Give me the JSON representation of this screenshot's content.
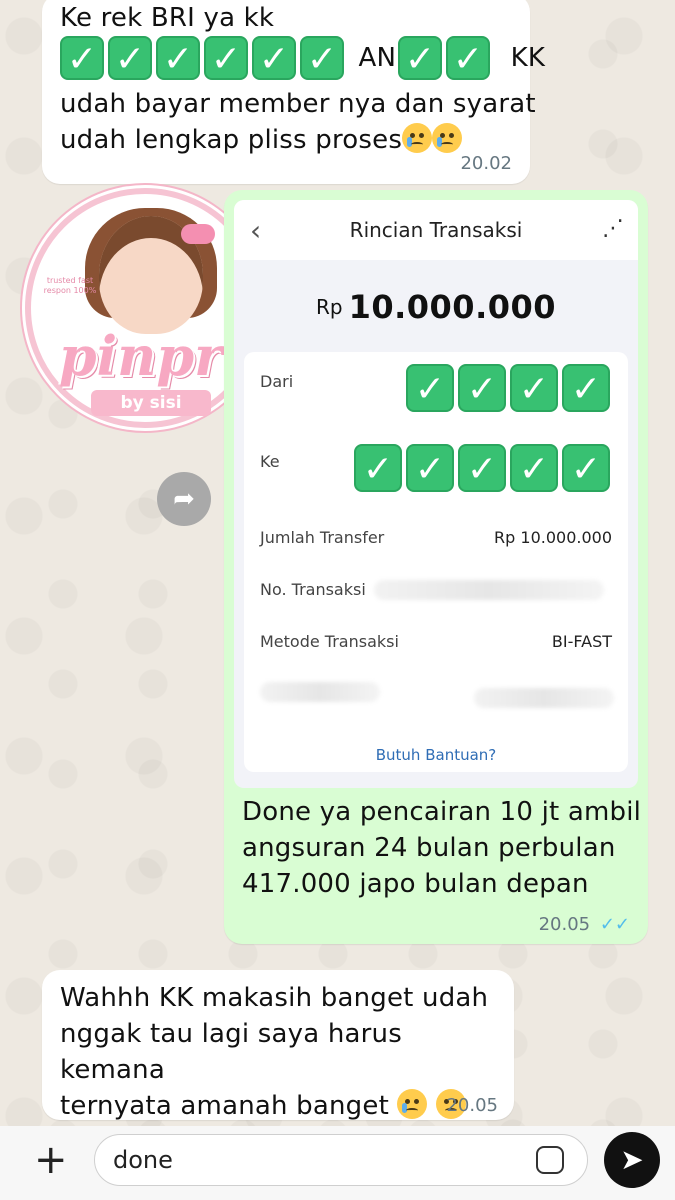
{
  "messages": {
    "m1": {
      "line1": "Ke rek BRI ya kk",
      "an_label": "AN",
      "kk_label": "KK",
      "line3": "udah bayar member nya dan syarat",
      "line4": "udah lengkap pliss proses",
      "time": "20.02"
    },
    "sticker": {
      "title": "pinpri",
      "subtitle": "by sisi",
      "tagline": "trusted fast respon 100%"
    },
    "receipt": {
      "title": "Rincian Transaksi",
      "currency": "Rp",
      "amount": "10.000.000",
      "from_label": "Dari",
      "to_label": "Ke",
      "transfer_amount_label": "Jumlah Transfer",
      "transfer_amount_value": "Rp 10.000.000",
      "transaction_no_label": "No. Transaksi",
      "method_label": "Metode Transaksi",
      "method_value": "BI-FAST",
      "help_link": "Butuh Bantuan?"
    },
    "m2": {
      "line1": "Done ya pencairan 10 jt ambil",
      "line2": "angsuran 24 bulan perbulan",
      "line3": "417.000 japo bulan depan",
      "time": "20.05",
      "status": "read"
    },
    "m3": {
      "line1": "Wahhh KK makasih banget udah",
      "line2": "nggak tau lagi saya harus kemana",
      "line3": "ternyata amanah banget",
      "time": "20.05"
    }
  },
  "composer": {
    "value": "done",
    "plus_icon": "+",
    "send_icon": "➤"
  },
  "colors": {
    "incoming_bubble": "#ffffff",
    "outgoing_bubble": "#d9fdd3",
    "read_ticks": "#53bdeb",
    "check_emoji": "#38c172"
  }
}
